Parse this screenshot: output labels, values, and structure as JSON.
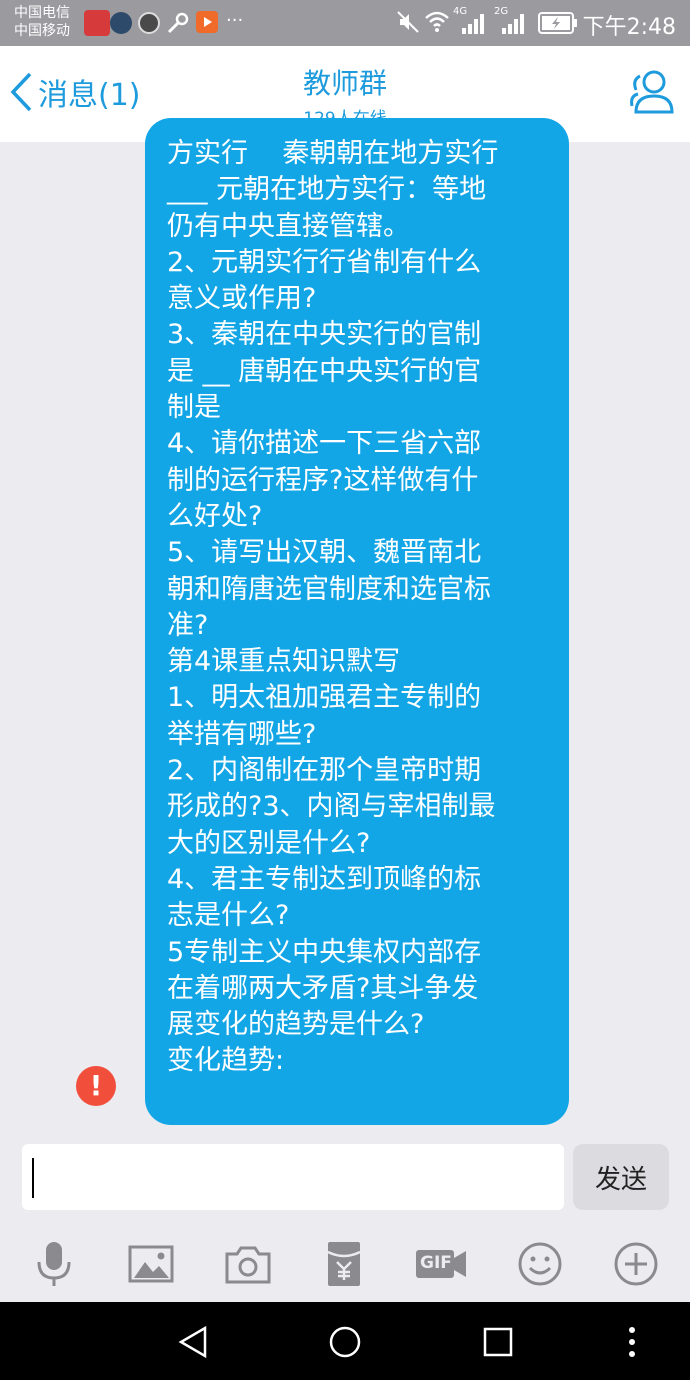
{
  "status_bar": {
    "carrier1": "中国电信",
    "carrier2": "中国移动",
    "network_4g": "4G",
    "network_2g": "2G",
    "time": "下午2:48",
    "more": "···"
  },
  "header": {
    "back_label": "消息(1)",
    "title": "教师群",
    "online": "129人在线"
  },
  "message": {
    "text": "方实行    秦朝朝在地方实行\n___ 元朝在地方实行：等地\n仍有中央直接管辖。\n2、元朝实行行省制有什么\n意义或作用?\n3、秦朝在中央实行的官制\n是 __ 唐朝在中央实行的官\n制是\n4、请你描述一下三省六部\n制的运行程序?这样做有什\n么好处?\n5、请写出汉朝、魏晋南北\n朝和隋唐选官制度和选官标\n准?\n第4课重点知识默写\n1、明太祖加强君主专制的\n举措有哪些?\n2、内阁制在那个皇帝时期\n形成的?3、内阁与宰相制最\n大的区别是什么?\n4、君主专制达到顶峰的标\n志是什么?\n5专制主义中央集权内部存\n在着哪两大矛盾?其斗争发\n展变化的趋势是什么?\n变化趋势:",
    "error_mark": "!"
  },
  "composer": {
    "send_label": "发送",
    "gif_label": "GIF"
  },
  "colors": {
    "accent": "#1e9bdc",
    "bubble": "#13a6e6",
    "error": "#f24e3c"
  }
}
